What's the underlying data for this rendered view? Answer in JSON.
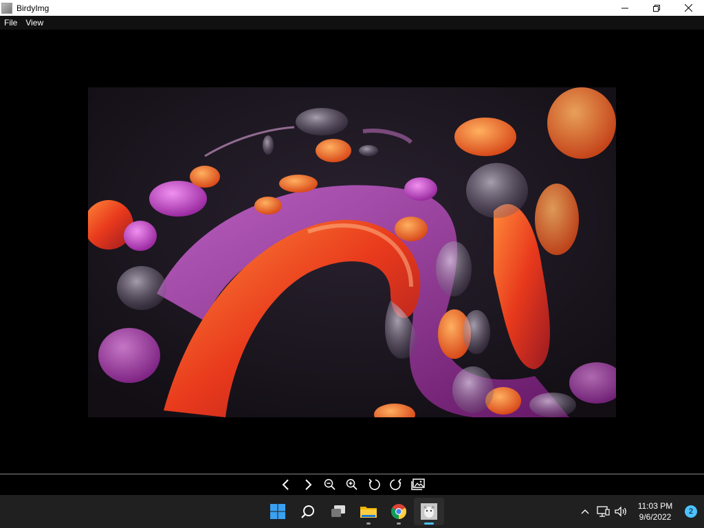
{
  "window": {
    "title": "BirdyImg",
    "controls": {
      "minimize_icon": "minimize-icon",
      "restore_icon": "restore-icon",
      "close_icon": "close-icon"
    }
  },
  "menu": {
    "items": [
      {
        "label": "File"
      },
      {
        "label": "View"
      }
    ]
  },
  "viewer": {
    "image_description_icon": "abstract-wallpaper-image"
  },
  "toolbar": {
    "buttons": [
      {
        "name": "previous",
        "icon": "chevron-left-icon"
      },
      {
        "name": "next",
        "icon": "chevron-right-icon"
      },
      {
        "name": "zoom-out",
        "icon": "zoom-out-icon"
      },
      {
        "name": "zoom-in",
        "icon": "zoom-in-icon"
      },
      {
        "name": "rotate-left",
        "icon": "rotate-left-icon"
      },
      {
        "name": "rotate-right",
        "icon": "rotate-right-icon"
      },
      {
        "name": "open-images",
        "icon": "image-stack-icon"
      }
    ]
  },
  "taskbar": {
    "apps": [
      {
        "name": "start",
        "icon": "windows-start-icon"
      },
      {
        "name": "search",
        "icon": "search-icon"
      },
      {
        "name": "task-view",
        "icon": "task-view-icon"
      },
      {
        "name": "file-explorer",
        "icon": "folder-icon",
        "running": true
      },
      {
        "name": "chrome",
        "icon": "chrome-icon",
        "running": true
      },
      {
        "name": "birdyimg",
        "icon": "birdyimg-icon",
        "running": true,
        "active": true
      }
    ],
    "tray": {
      "time": "11:03 PM",
      "date": "9/6/2022",
      "notifications": "2"
    }
  },
  "colors": {
    "accent": "#4cc2ff",
    "taskbar": "#202020"
  }
}
